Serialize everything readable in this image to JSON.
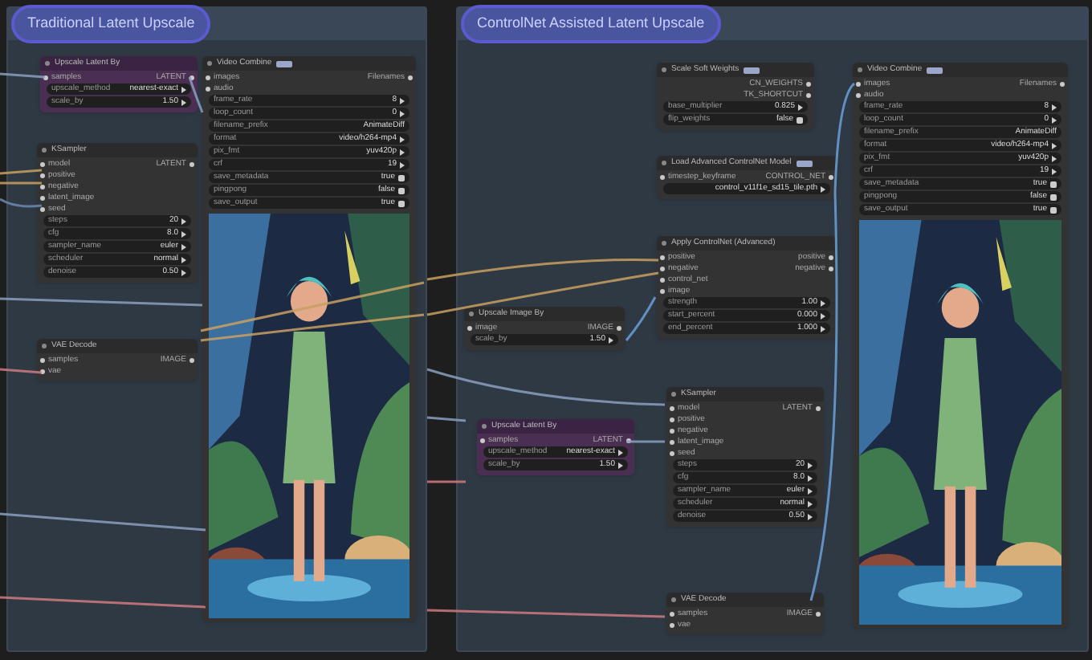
{
  "groups": [
    {
      "title": "Traditional Latent Upscale",
      "nodes": [
        {
          "title": "Upscale Latent By",
          "kind": "latent",
          "badge": false,
          "io": [
            {
              "in": "samples",
              "out": "LATENT"
            }
          ],
          "widgets": [
            {
              "name": "upscale_method",
              "value": "nearest-exact",
              "kind": "combo"
            },
            {
              "name": "scale_by",
              "value": "1.50",
              "kind": "number"
            }
          ]
        },
        {
          "title": "KSampler",
          "kind": "plain",
          "badge": false,
          "io": [
            {
              "in": "model",
              "out": "LATENT"
            },
            {
              "in": "positive"
            },
            {
              "in": "negative"
            },
            {
              "in": "latent_image"
            },
            {
              "in": "seed"
            }
          ],
          "widgets": [
            {
              "name": "steps",
              "value": "20",
              "kind": "number"
            },
            {
              "name": "cfg",
              "value": "8.0",
              "kind": "number"
            },
            {
              "name": "sampler_name",
              "value": "euler",
              "kind": "combo"
            },
            {
              "name": "scheduler",
              "value": "normal",
              "kind": "combo"
            },
            {
              "name": "denoise",
              "value": "0.50",
              "kind": "number"
            }
          ]
        },
        {
          "title": "VAE Decode",
          "kind": "plain",
          "badge": false,
          "io": [
            {
              "in": "samples",
              "out": "IMAGE"
            },
            {
              "in": "vae"
            }
          ]
        },
        {
          "title": "Video Combine",
          "kind": "preview",
          "badge": true,
          "io": [
            {
              "in": "images",
              "out": "Filenames"
            },
            {
              "in": "audio"
            }
          ],
          "widgets": [
            {
              "name": "frame_rate",
              "value": "8",
              "kind": "number"
            },
            {
              "name": "loop_count",
              "value": "0",
              "kind": "number"
            },
            {
              "name": "filename_prefix",
              "value": "AnimateDiff",
              "kind": "text"
            },
            {
              "name": "format",
              "value": "video/h264-mp4",
              "kind": "combo"
            },
            {
              "name": "pix_fmt",
              "value": "yuv420p",
              "kind": "combo"
            },
            {
              "name": "crf",
              "value": "19",
              "kind": "number"
            },
            {
              "name": "save_metadata",
              "value": "true",
              "kind": "toggle"
            },
            {
              "name": "pingpong",
              "value": "false",
              "kind": "toggle"
            },
            {
              "name": "save_output",
              "value": "true",
              "kind": "toggle"
            }
          ]
        }
      ]
    },
    {
      "title": "ControlNet Assisted Latent Upscale",
      "nodes": [
        {
          "title": "Scale Soft Weights",
          "kind": "plain",
          "badge": true,
          "io": [
            {
              "out": "CN_WEIGHTS"
            },
            {
              "out": "TK_SHORTCUT"
            }
          ],
          "widgets": [
            {
              "name": "base_multiplier",
              "value": "0.825",
              "kind": "number"
            },
            {
              "name": "flip_weights",
              "value": "false",
              "kind": "toggle"
            }
          ]
        },
        {
          "title": "Load Advanced ControlNet Model",
          "kind": "plain",
          "badge": true,
          "io": [
            {
              "in": "timestep_keyframe",
              "out": "CONTROL_NET"
            }
          ],
          "widgets": [
            {
              "value": "control_v11f1e_sd15_tile.pth",
              "kind": "combo"
            }
          ]
        },
        {
          "title": "Apply ControlNet (Advanced)",
          "kind": "plain",
          "badge": false,
          "io": [
            {
              "in": "positive",
              "out": "positive"
            },
            {
              "in": "negative",
              "out": "negative"
            },
            {
              "in": "control_net"
            },
            {
              "in": "image"
            }
          ],
          "widgets": [
            {
              "name": "strength",
              "value": "1.00",
              "kind": "number"
            },
            {
              "name": "start_percent",
              "value": "0.000",
              "kind": "number"
            },
            {
              "name": "end_percent",
              "value": "1.000",
              "kind": "number"
            }
          ]
        },
        {
          "title": "Upscale Image By",
          "kind": "plain",
          "badge": false,
          "io": [
            {
              "in": "image",
              "out": "IMAGE"
            }
          ],
          "widgets": [
            {
              "name": "scale_by",
              "value": "1.50",
              "kind": "number"
            }
          ]
        },
        {
          "title": "Upscale Latent By",
          "kind": "latent",
          "badge": false,
          "io": [
            {
              "in": "samples",
              "out": "LATENT"
            }
          ],
          "widgets": [
            {
              "name": "upscale_method",
              "value": "nearest-exact",
              "kind": "combo"
            },
            {
              "name": "scale_by",
              "value": "1.50",
              "kind": "number"
            }
          ]
        },
        {
          "title": "KSampler",
          "kind": "plain",
          "badge": false,
          "io": [
            {
              "in": "model",
              "out": "LATENT"
            },
            {
              "in": "positive"
            },
            {
              "in": "negative"
            },
            {
              "in": "latent_image"
            },
            {
              "in": "seed"
            }
          ],
          "widgets": [
            {
              "name": "steps",
              "value": "20",
              "kind": "number"
            },
            {
              "name": "cfg",
              "value": "8.0",
              "kind": "number"
            },
            {
              "name": "sampler_name",
              "value": "euler",
              "kind": "combo"
            },
            {
              "name": "scheduler",
              "value": "normal",
              "kind": "combo"
            },
            {
              "name": "denoise",
              "value": "0.50",
              "kind": "number"
            }
          ]
        },
        {
          "title": "VAE Decode",
          "kind": "plain",
          "badge": false,
          "io": [
            {
              "in": "samples",
              "out": "IMAGE"
            },
            {
              "in": "vae"
            }
          ]
        },
        {
          "title": "Video Combine",
          "kind": "preview",
          "badge": true,
          "io": [
            {
              "in": "images",
              "out": "Filenames"
            },
            {
              "in": "audio"
            }
          ],
          "widgets": [
            {
              "name": "frame_rate",
              "value": "8",
              "kind": "number"
            },
            {
              "name": "loop_count",
              "value": "0",
              "kind": "number"
            },
            {
              "name": "filename_prefix",
              "value": "AnimateDiff",
              "kind": "text"
            },
            {
              "name": "format",
              "value": "video/h264-mp4",
              "kind": "combo"
            },
            {
              "name": "pix_fmt",
              "value": "yuv420p",
              "kind": "combo"
            },
            {
              "name": "crf",
              "value": "19",
              "kind": "number"
            },
            {
              "name": "save_metadata",
              "value": "true",
              "kind": "toggle"
            },
            {
              "name": "pingpong",
              "value": "false",
              "kind": "toggle"
            },
            {
              "name": "save_output",
              "value": "true",
              "kind": "toggle"
            }
          ]
        }
      ]
    }
  ]
}
